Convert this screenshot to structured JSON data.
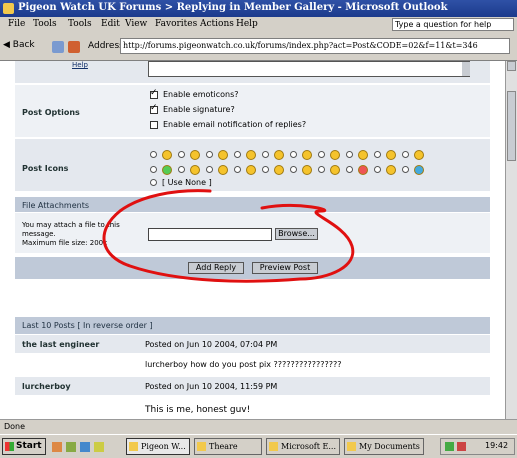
{
  "window": {
    "title": "Pigeon Watch UK Forums > Replying in Member Gallery - Microsoft Outlook"
  },
  "menubar": {
    "items": [
      "File",
      "Tools",
      "Tools",
      "Edit",
      "View",
      "Favorites",
      "Actions",
      "Help"
    ],
    "help_placeholder": "Type a question for help"
  },
  "addressbar": {
    "back_label": "Back",
    "address_label": "Address",
    "url": "http://forums.pigeonwatch.co.uk/forums/index.php?act=Post&CODE=02&f=11&t=346"
  },
  "form": {
    "help_link": "Help",
    "post_options": {
      "label": "Post Options",
      "options": [
        {
          "label": "Enable emoticons?",
          "checked": true
        },
        {
          "label": "Enable signature?",
          "checked": true
        },
        {
          "label": "Enable email notification of replies?",
          "checked": false
        }
      ]
    },
    "post_icons": {
      "label": "Post Icons",
      "no_icon_label": "[ Use None ]"
    },
    "file_attachments": {
      "header": "File Attachments",
      "description_line1": "You may attach a file to this",
      "description_line2": "message.",
      "description_line3": "Maximum file size: 200k",
      "browse_label": "Browse..."
    },
    "add_reply_label": "Add Reply",
    "preview_post_label": "Preview Post"
  },
  "last_posts": {
    "header": "Last 10 Posts [ In reverse order ]",
    "posts": [
      {
        "author": "the last engineer",
        "posted": "Posted on Jun 10 2004, 07:04 PM",
        "body": "lurcherboy how do you post pix ????????????????"
      },
      {
        "author": "lurcherboy",
        "posted": "Posted on Jun 10 2004, 11:59 PM",
        "body": "This is me, honest guv!"
      }
    ]
  },
  "statusbar": {
    "text": "Done"
  },
  "taskbar": {
    "start_label": "Start",
    "tasks": [
      "Pigeon W...",
      "Theare",
      "Microsoft E...",
      "My Documents"
    ],
    "clock": "19:42"
  },
  "colors": {
    "titlebar": "#1b3a8c",
    "form_row_bg": "#e4e8ee",
    "section_header_bg": "#bfc9d8",
    "annotation_red": "#e01010"
  }
}
